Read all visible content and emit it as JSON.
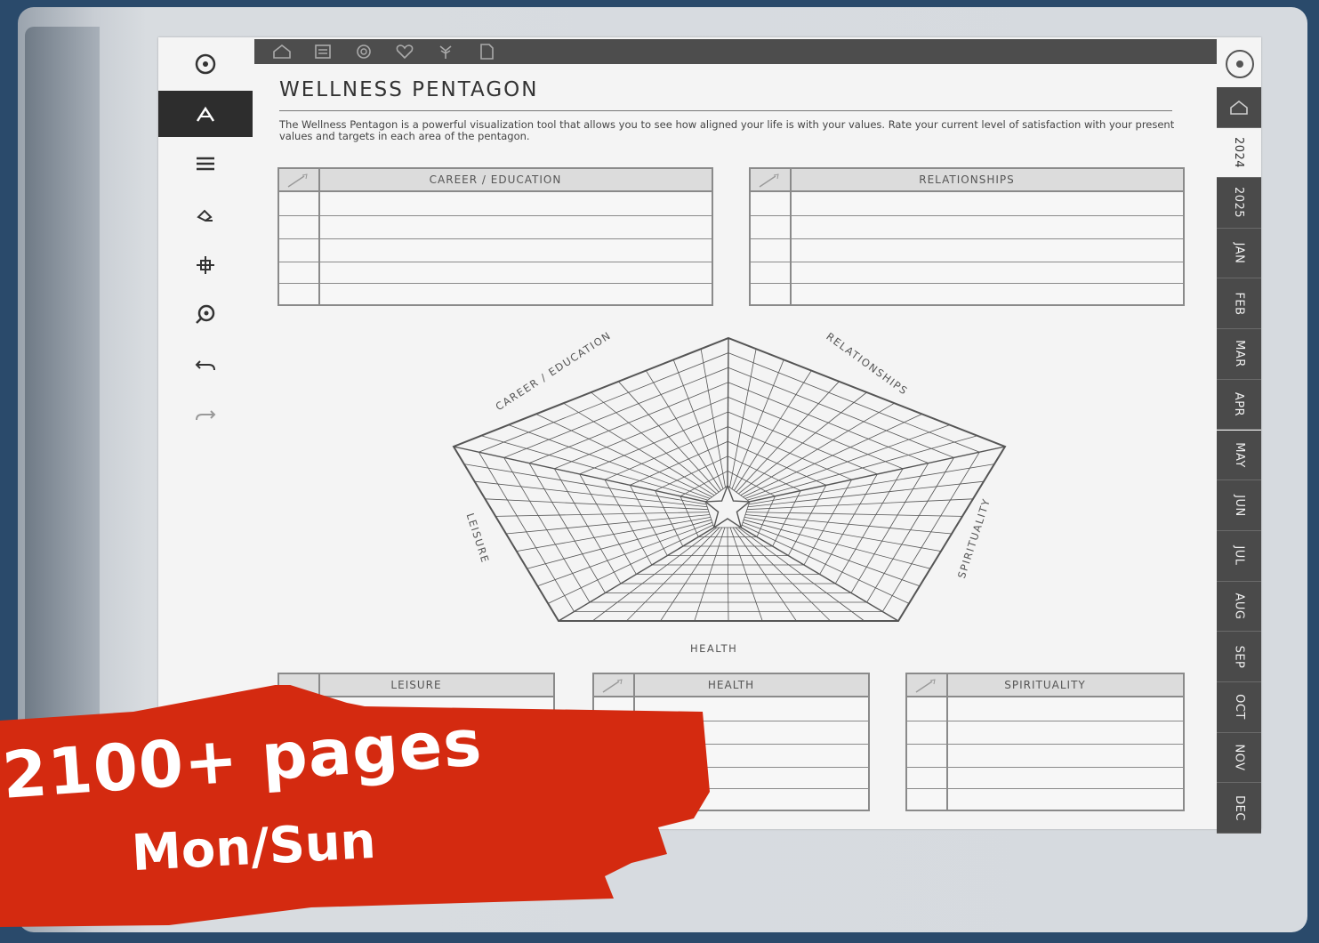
{
  "page": {
    "title": "WELLNESS PENTAGON",
    "intro": "The Wellness Pentagon is a powerful visualization tool that allows you to see how aligned your life is with your values. Rate your current level of satisfaction with your present values and targets in each area of the pentagon."
  },
  "tables": {
    "career": "CAREER / EDUCATION",
    "relationships": "RELATIONSHIPS",
    "leisure": "LEISURE",
    "health": "HEALTH",
    "spirituality": "SPIRITUALITY"
  },
  "pentagon": {
    "career": "CAREER / EDUCATION",
    "relationships": "RELATIONSHIPS",
    "spirituality": "SPIRITUALITY",
    "health": "HEALTH",
    "leisure": "LEISURE"
  },
  "right_tabs": [
    "2024",
    "2025",
    "JAN",
    "FEB",
    "MAR",
    "APR",
    "MAY",
    "JUN",
    "JUL",
    "AUG",
    "SEP",
    "OCT",
    "NOV",
    "DEC"
  ],
  "left_toolbar": [
    "hide-menu-icon",
    "pen-icon",
    "menu-icon",
    "eraser-icon",
    "move-icon",
    "zoom-icon",
    "undo-icon",
    "redo-icon"
  ],
  "top_nav_icons": [
    "home-icon",
    "notebook-icon",
    "goals-icon",
    "heart-icon",
    "tree-icon",
    "page-icon"
  ],
  "promo": {
    "line1": "2100+ pages",
    "line2": "Mon/Sun",
    "color": "#d42a10"
  }
}
